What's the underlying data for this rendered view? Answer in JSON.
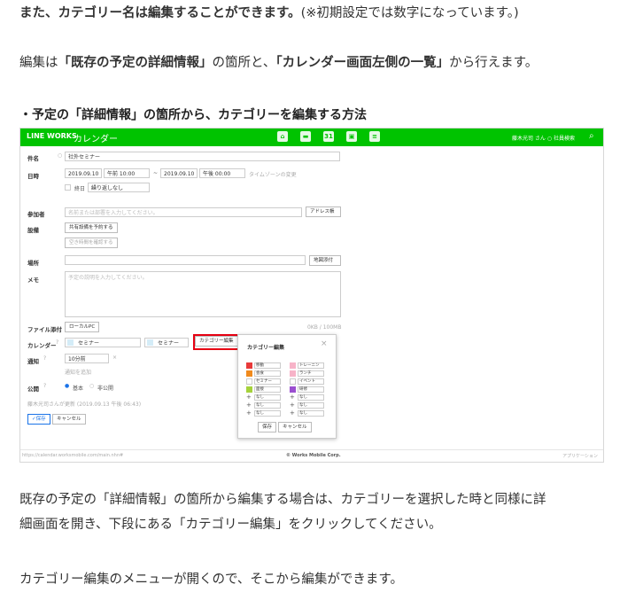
{
  "article": {
    "p1_bold": "また、カテゴリー名は編集することができます。",
    "p1_note": "(※初期設定では数字になっています。)",
    "p2_a": "編集は",
    "p2_b": "「既存の予定の詳細情報」",
    "p2_c": "の箇所と、",
    "p2_d": "「カレンダー画面左側の一覧」",
    "p2_e": "から行えます。",
    "heading": "・予定の「詳細情報」の箇所から、カテゴリーを編集する方法",
    "p3_line1": "既存の予定の「詳細情報」の箇所から編集する場合は、カテゴリーを選択した時と同様に詳",
    "p3_line2": "細画面を開き、下段にある「カテゴリー編集」をクリックしてください。",
    "p4": "カテゴリー編集のメニューが開くので、そこから編集ができます。"
  },
  "app": {
    "logo": "LINE WORKS",
    "title": "カレンダー",
    "user": "藤木光司 さん ○",
    "menu": "社員検索",
    "icons": [
      "home-icon",
      "chat-icon",
      "calendar-icon",
      "contacts-icon",
      "mail-icon"
    ],
    "calendar_icon_text": "31",
    "accent": "#00c300"
  },
  "form": {
    "title_label": "件名",
    "title_value": "社外セミナー",
    "date_label": "日時",
    "start_date": "2019.09.10",
    "start_time": "午前 10:00",
    "tilde": "~",
    "end_date": "2019.09.10",
    "end_time": "午後 00:00",
    "timezone": "タイムゾーンの変更",
    "allday": "終日",
    "repeat": "繰り返しなし",
    "attendee_label": "参加者",
    "attendee_placeholder": "名前または部署を入力してください。",
    "address_book": "アドレス帳",
    "facility_label": "設備",
    "facility_button": "共有設備を予約する",
    "free_time_button": "空き時間を確認する",
    "place_label": "場所",
    "map_button": "地図添付",
    "memo_label": "メモ",
    "memo_placeholder": "予定の説明を入力してください。",
    "file_label": "ファイル添付",
    "local_pc": "ローカルPC",
    "file_size": "0KB / 100MB",
    "calendar_label": "カレンダー",
    "calendar_value": "セミナー",
    "category_value": "セミナー",
    "category_edit": "カテゴリー編集",
    "notify_label": "通知",
    "notify_value": "10分前",
    "notify_add": "通知を追加",
    "public_label": "公開",
    "public_basic": "基本",
    "public_private": "非公開",
    "updated": "藤木光司さんが更新 (2019.09.13 午後 06:43)",
    "save": "保存",
    "cancel": "キャンセル"
  },
  "popup": {
    "title": "カテゴリー編集",
    "left": [
      {
        "color": "#e83a3a",
        "name": "移動"
      },
      {
        "color": "#f08a1c",
        "name": "会食"
      },
      {
        "color": "#ffffff",
        "name": "セミナー"
      },
      {
        "color": "#a5d23b",
        "name": "面接"
      },
      {
        "color": "",
        "name": "なし"
      },
      {
        "color": "",
        "name": "なし"
      },
      {
        "color": "",
        "name": "なし"
      }
    ],
    "right": [
      {
        "color": "#f7b3c8",
        "name": "トレーニン"
      },
      {
        "color": "#f7b3c8",
        "name": "ランチ"
      },
      {
        "color": "#ffffff",
        "name": "イベント"
      },
      {
        "color": "#9b4fd0",
        "name": "研修"
      },
      {
        "color": "",
        "name": "なし"
      },
      {
        "color": "",
        "name": "なし"
      },
      {
        "color": "",
        "name": "なし"
      }
    ],
    "plus": "+",
    "save": "保存",
    "cancel": "キャンセル",
    "close": "×"
  },
  "footer": {
    "url": "https://calendar.worksmobile.com/main.nhn#",
    "copyright": "© Works Mobile Corp.",
    "apps": "アプリケーション"
  }
}
